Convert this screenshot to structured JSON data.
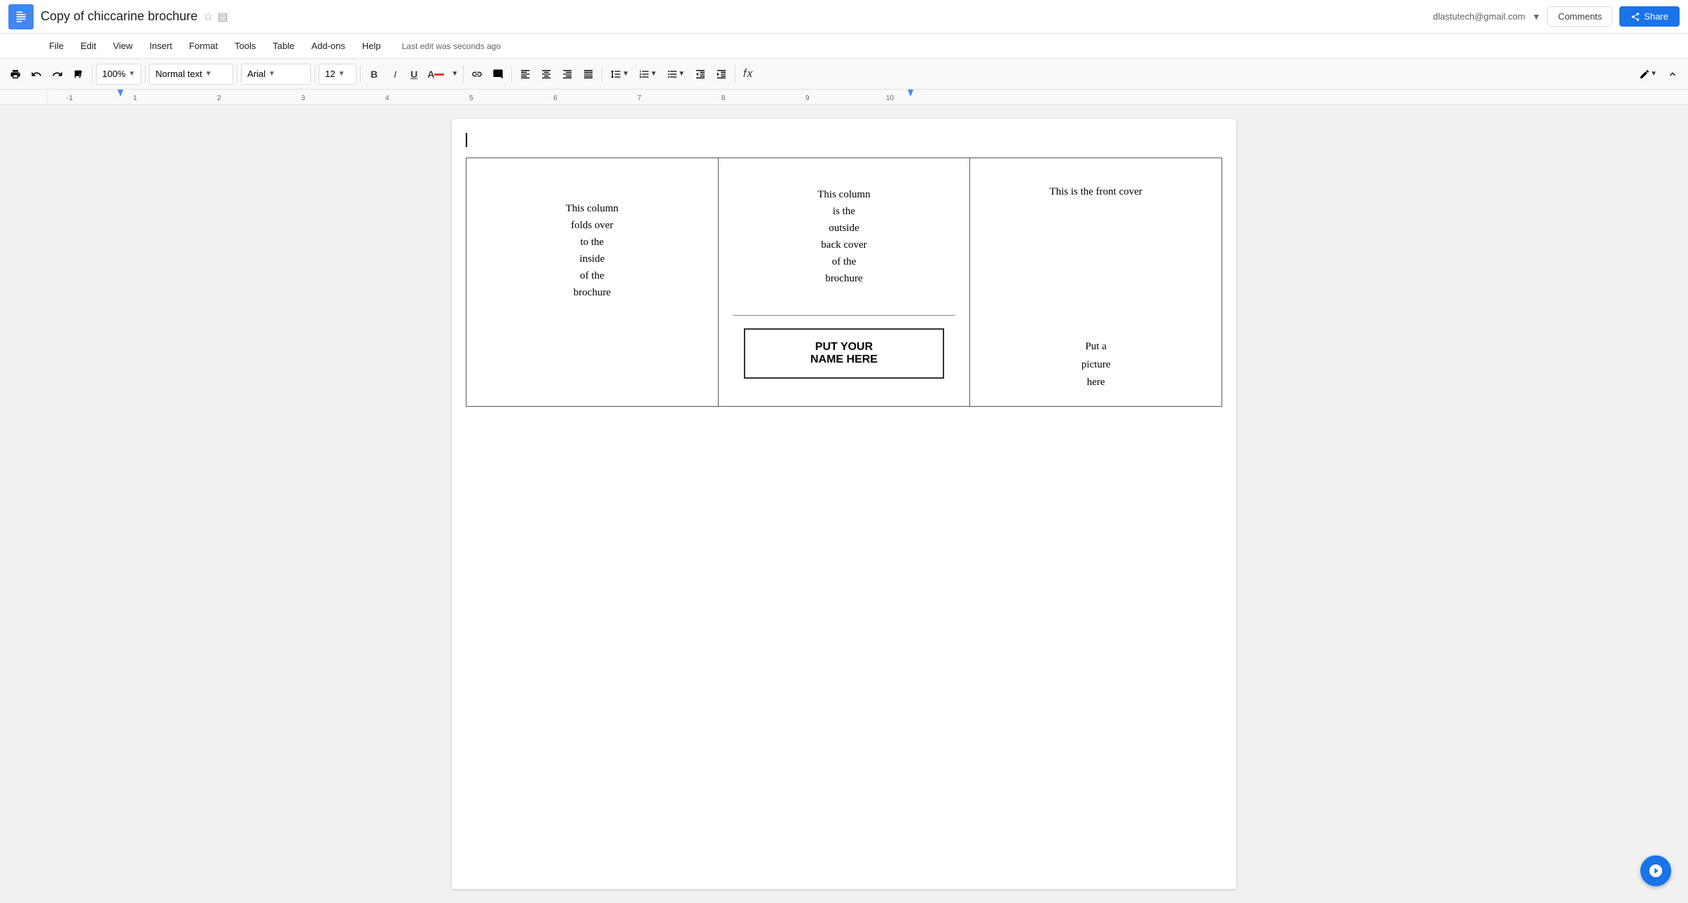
{
  "topbar": {
    "doc_title": "Copy of chiccarine brochure",
    "star_label": "★",
    "folder_label": "📁",
    "user_email": "dlastutech@gmail.com",
    "comments_label": "Comments",
    "share_label": "Share"
  },
  "menubar": {
    "items": [
      "File",
      "Edit",
      "View",
      "Insert",
      "Format",
      "Tools",
      "Table",
      "Add-ons",
      "Help"
    ],
    "last_edit": "Last edit was seconds ago"
  },
  "toolbar": {
    "zoom": "100%",
    "style": "Normal text",
    "font": "Arial",
    "font_size": "12",
    "bold": "B",
    "italic": "I",
    "underline": "U"
  },
  "document": {
    "col1_text": "This column\nfolds over\nto the\ninside\nof the\nbrochure",
    "col2_top_text": "This column\nis the\noutside\nback cover\nof the\nbrochure",
    "name_box_line1": "PUT YOUR",
    "name_box_line2": "NAME HERE",
    "col3_top_text": "This is the front cover",
    "col3_bottom_text": "Put a\npicture\nhere"
  }
}
